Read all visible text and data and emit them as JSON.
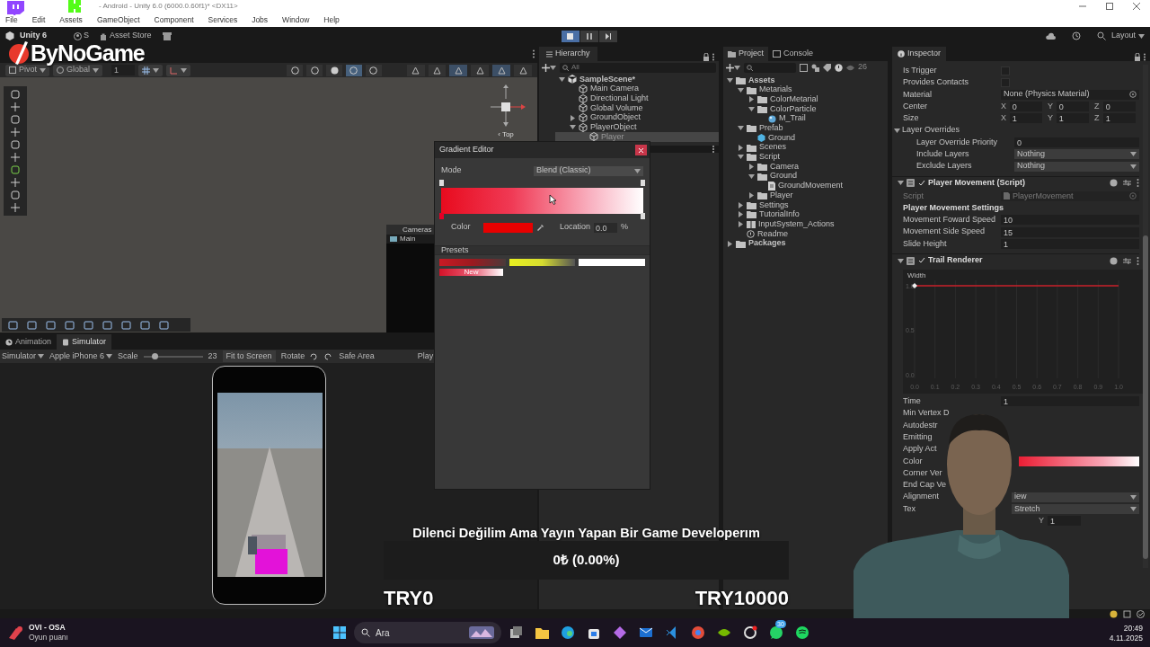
{
  "window": {
    "title": "- Android - Unity 6.0 (6000.0.60f1)* <DX11>"
  },
  "menu": [
    "File",
    "Edit",
    "Assets",
    "GameObject",
    "Component",
    "Services",
    "Jobs",
    "Window",
    "Help"
  ],
  "toolbar": {
    "unity": "Unity 6",
    "account": "S",
    "asset_store": "Asset Store",
    "layout": "Layout"
  },
  "stream_logo": "ByNoGame",
  "scene_toolbar": {
    "pivot": "Pivot",
    "global": "Global",
    "grid": "1"
  },
  "scene": {
    "gizmo_label": "‹ Top",
    "camera_preview": {
      "title": "Cameras",
      "tab": "Main"
    }
  },
  "hierarchy": {
    "title": "Hierarchy",
    "search": "All",
    "items": [
      {
        "label": "SampleScene*",
        "kind": "scene",
        "expanded": true,
        "selected": false,
        "children": [
          {
            "label": "Main Camera",
            "kind": "object",
            "selected": false
          },
          {
            "label": "Directional Light",
            "kind": "object",
            "selected": false
          },
          {
            "label": "Global Volume",
            "kind": "object",
            "selected": false
          },
          {
            "label": "GroundObject",
            "kind": "object",
            "expanded": false,
            "selected": false
          },
          {
            "label": "PlayerObject",
            "kind": "object",
            "expanded": true,
            "selected": false,
            "children": [
              {
                "label": "Player",
                "kind": "object",
                "selected": true
              }
            ]
          }
        ]
      }
    ]
  },
  "project": {
    "tabs": [
      {
        "label": "Project",
        "selected": true
      },
      {
        "label": "Console",
        "selected": false
      }
    ],
    "count": "26",
    "items": [
      {
        "label": "Assets",
        "kind": "folder",
        "expanded": true,
        "children": [
          {
            "label": "Metarials",
            "kind": "folder",
            "expanded": true,
            "children": [
              {
                "label": "ColorMetarial",
                "kind": "folder",
                "expanded": false
              },
              {
                "label": "ColorParticle",
                "kind": "folder",
                "expanded": true,
                "children": [
                  {
                    "label": "M_Trail",
                    "kind": "material"
                  }
                ]
              }
            ]
          },
          {
            "label": "Prefab",
            "kind": "folder",
            "expanded": true,
            "children": [
              {
                "label": "Ground",
                "kind": "prefab"
              }
            ]
          },
          {
            "label": "Scenes",
            "kind": "folder",
            "expanded": false
          },
          {
            "label": "Script",
            "kind": "folder",
            "expanded": true,
            "children": [
              {
                "label": "Camera",
                "kind": "folder",
                "expanded": false
              },
              {
                "label": "Ground",
                "kind": "folder",
                "expanded": true,
                "children": [
                  {
                    "label": "GroundMovement",
                    "kind": "script"
                  }
                ]
              },
              {
                "label": "Player",
                "kind": "folder",
                "expanded": false
              }
            ]
          },
          {
            "label": "Settings",
            "kind": "folder",
            "expanded": false
          },
          {
            "label": "TutorialInfo",
            "kind": "folder",
            "expanded": false
          },
          {
            "label": "InputSystem_Actions",
            "kind": "actions",
            "expanded": false
          },
          {
            "label": "Readme",
            "kind": "readme"
          }
        ]
      },
      {
        "label": "Packages",
        "kind": "folder",
        "expanded": false
      }
    ]
  },
  "inspector": {
    "title": "Inspector",
    "rows": [
      {
        "kind": "checkbox",
        "label": "Is Trigger",
        "checked": false
      },
      {
        "kind": "checkbox",
        "label": "Provides Contacts",
        "checked": false
      },
      {
        "kind": "object",
        "label": "Material",
        "value": "None (Physics Material)"
      },
      {
        "kind": "vector",
        "label": "Center",
        "axes": [
          {
            "axis": "X",
            "value": "0"
          },
          {
            "axis": "Y",
            "value": "0"
          },
          {
            "axis": "Z",
            "value": "0"
          }
        ]
      },
      {
        "kind": "vector",
        "label": "Size",
        "axes": [
          {
            "axis": "X",
            "value": "1"
          },
          {
            "axis": "Y",
            "value": "1"
          },
          {
            "axis": "Z",
            "value": "1"
          }
        ]
      },
      {
        "kind": "foldout",
        "label": "Layer Overrides",
        "expanded": true,
        "children": [
          {
            "kind": "field",
            "label": "Layer Override Priority",
            "value": "0"
          },
          {
            "kind": "dropdown",
            "label": "Include Layers",
            "value": "Nothing"
          },
          {
            "kind": "dropdown",
            "label": "Exclude Layers",
            "value": "Nothing"
          }
        ]
      },
      {
        "kind": "component",
        "label": "Player Movement (Script)",
        "enabled": true,
        "expanded": true,
        "children": [
          {
            "kind": "object",
            "label": "Script",
            "value": "PlayerMovement",
            "disabled": true
          },
          {
            "kind": "header",
            "label": "Player Movement Settings"
          },
          {
            "kind": "field",
            "label": "Movement Foward Speed",
            "value": "10"
          },
          {
            "kind": "field",
            "label": "Movement Side Speed",
            "value": "15"
          },
          {
            "kind": "field",
            "label": "Slide Height",
            "value": "1"
          }
        ]
      },
      {
        "kind": "component",
        "label": "Trail Renderer",
        "enabled": true,
        "expanded": true,
        "children": [
          {
            "kind": "curve",
            "label": "Width",
            "chart_data": {
              "type": "line",
              "grid": true,
              "x": [
                0,
                1
              ],
              "series": [
                {
                  "color": "#c8202a",
                  "values": [
                    1,
                    1
                  ]
                }
              ],
              "xlim": [
                0,
                1
              ],
              "ylim": [
                0,
                1
              ],
              "xticks": [
                {
                  "value": 0,
                  "label": "0.0"
                },
                {
                  "value": 0.1,
                  "label": "0.1"
                },
                {
                  "value": 0.2,
                  "label": "0.2"
                },
                {
                  "value": 0.3,
                  "label": "0.3"
                },
                {
                  "value": 0.4,
                  "label": "0.4"
                },
                {
                  "value": 0.5,
                  "label": "0.5"
                },
                {
                  "value": 0.6,
                  "label": "0.6"
                },
                {
                  "value": 0.7,
                  "label": "0.7"
                },
                {
                  "value": 0.8,
                  "label": "0.8"
                },
                {
                  "value": 0.9,
                  "label": "0.9"
                },
                {
                  "value": 1,
                  "label": "1.0"
                }
              ],
              "yticks": [
                {
                  "value": 0,
                  "label": "0.0"
                },
                {
                  "value": 0.5,
                  "label": "0.5"
                },
                {
                  "value": 1,
                  "label": "1.0"
                }
              ]
            }
          },
          {
            "kind": "field",
            "label": "Time",
            "value": "1"
          },
          {
            "kind": "label",
            "label": "Min Vertex D"
          },
          {
            "kind": "label",
            "label": "Autodestr"
          },
          {
            "kind": "label",
            "label": "Emitting"
          },
          {
            "kind": "label",
            "label": "Apply Act"
          },
          {
            "kind": "gradient",
            "label": "Color"
          },
          {
            "kind": "label",
            "label": "Corner Ver"
          },
          {
            "kind": "label",
            "label": "End Cap Ve"
          },
          {
            "kind": "dropdown",
            "label": "Alignment",
            "value": "iew"
          },
          {
            "kind": "dropdown",
            "label": "Tex",
            "value": "Stretch"
          },
          {
            "kind": "vector",
            "axes": [
              {
                "axis": "Y",
                "value": "1"
              }
            ]
          }
        ]
      }
    ]
  },
  "gradient_editor": {
    "title": "Gradient Editor",
    "mode_label": "Mode",
    "mode": "Blend (Classic)",
    "color_label": "Color",
    "location_label": "Location",
    "location": "0.0",
    "unit": "%",
    "presets_label": "Presets",
    "presets": [
      {
        "kind": "red"
      },
      {
        "kind": "yellow"
      },
      {
        "kind": "white"
      },
      {
        "kind": "red_white",
        "label": "New"
      }
    ]
  },
  "simulator": {
    "tabs": [
      {
        "label": "Animation",
        "kind": "clock",
        "selected": false
      },
      {
        "label": "Simulator",
        "kind": "phone",
        "selected": true
      }
    ],
    "mode": "Simulator",
    "device": "Apple iPhone 6",
    "scale_label": "Scale",
    "scale": {
      "level": 0.2
    },
    "scale_value": "23",
    "fit": "Fit to Screen",
    "rotate": "Rotate",
    "safe_area": "Safe Area",
    "play": "Play"
  },
  "stream": {
    "headline": "Dilenci Değilim Ama Yayın Yapan Bir Game Developerım",
    "goal": {
      "reading": "0₺ (0.00%)",
      "min": "TRY0",
      "max": "TRY10000"
    }
  },
  "taskbar": {
    "notification": {
      "title": "OVI - OSA",
      "subtitle": "Oyun puanı"
    },
    "search": "Ara",
    "badge": "30",
    "time": "20:49",
    "date": "4.11.2025"
  }
}
